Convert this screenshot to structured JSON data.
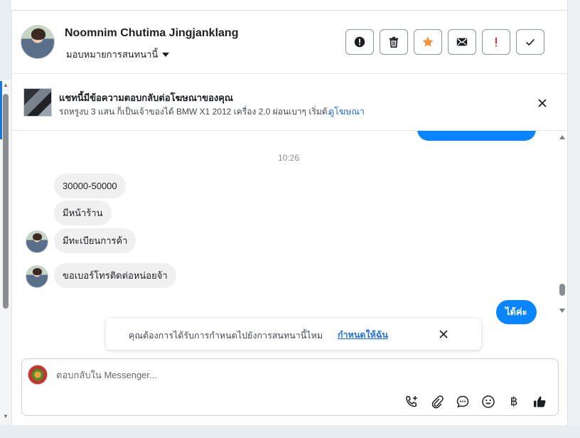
{
  "contact": {
    "name": "Noomnim Chutima Jingjanklang",
    "assign_label": "มอบหมายการสนทนานี้"
  },
  "actions": [
    {
      "name": "spam-button",
      "icon": "alert-circle-icon"
    },
    {
      "name": "delete-button",
      "icon": "trash-icon"
    },
    {
      "name": "star-button",
      "icon": "star-icon",
      "color": "#f7923a"
    },
    {
      "name": "mark-unread-button",
      "icon": "envelope-icon"
    },
    {
      "name": "follow-up-button",
      "icon": "exclamation-icon",
      "color": "#e02020"
    },
    {
      "name": "mark-done-button",
      "icon": "checkmark-icon"
    }
  ],
  "ad_banner": {
    "title": "แชทนี้มีข้อความตอบกลับต่อโฆษณาของคุณ",
    "description": "รถหรูงบ 3 แสน ก็เป็นเจ้าของได้ BMW X1 2012 เครื่อง 2.0 ผ่อนเบาๆ เริ่มต้...",
    "link": "ดูโฆษณา"
  },
  "chat": {
    "timestamp": "10:26",
    "incoming": [
      {
        "text": "30000-50000",
        "avatar": false
      },
      {
        "text": "มีหน้าร้าน",
        "avatar": false
      },
      {
        "text": "มีทะเบียนการค้า",
        "avatar": true
      },
      {
        "text": "ขอเบอร์โทรติดต่อหน่อยจ้า",
        "avatar": true
      }
    ],
    "outgoing_last": "ได้ค่ะ"
  },
  "toast": {
    "text": "คุณต้องการได้รับการกำหนดไปยังการสนทนานี้ไหม",
    "link": "กำหนดให้ฉัน"
  },
  "composer": {
    "placeholder": "ตอบกลับใน Messenger...",
    "tools": [
      "phone-add-icon",
      "paperclip-icon",
      "saved-reply-icon",
      "emoji-icon",
      "baht-icon",
      "thumbs-up-icon"
    ],
    "baht_symbol": "฿"
  }
}
